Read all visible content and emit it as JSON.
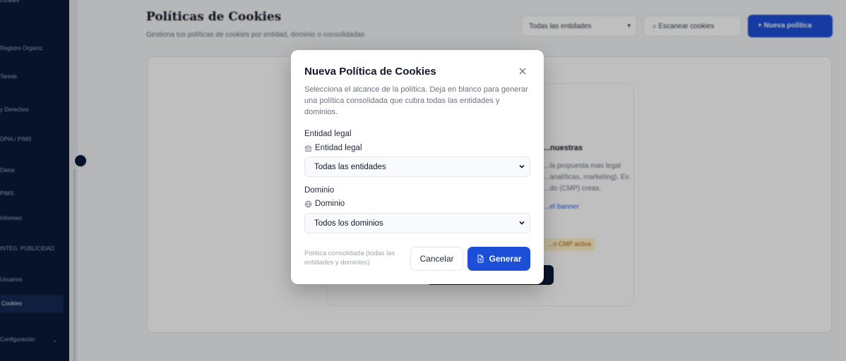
{
  "sidebar": {
    "items": [
      {
        "label": "cookies"
      },
      {
        "label": "Registro Organiz."
      },
      {
        "label": "Tareas"
      },
      {
        "label": "y Derechos"
      },
      {
        "label": "DPIA / PIMS"
      },
      {
        "label": "Datos"
      },
      {
        "label": "PIMS"
      },
      {
        "label": "Informes"
      },
      {
        "label": "INTEG. PÚBLICIDAD"
      },
      {
        "label": "Usuarios"
      },
      {
        "label": "Cookies"
      },
      {
        "label": "Configuración"
      }
    ]
  },
  "page": {
    "title": "Políticas de Cookies",
    "subtitle": "Gestiona tus políticas de cookies por entidad, dominio o consolidadas",
    "entity_filter": "Todas las entidades",
    "scan_button": "Escanear cookies",
    "new_button": "Nueva política"
  },
  "background_card": {
    "heading": "...nuestras",
    "lines": [
      "...la propuesta mas legal",
      "...analíticas, marketing). Es",
      "...do (CMP) creas."
    ],
    "link": "...el banner",
    "badge": "...n CMP activa"
  },
  "modal": {
    "title": "Nueva Política de Cookies",
    "description": "Selecciona el alcance de la política. Deja en blanco para generar una política consolidada que cubra todas las entidades y dominios.",
    "entity": {
      "label": "Entidad legal",
      "sublabel": "Entidad legal",
      "value": "Todas las entidades"
    },
    "domain": {
      "label": "Dominio",
      "sublabel": "Dominio",
      "value": "Todos los dominios"
    },
    "footer_note": "Política consolidada (todas las entidades y dominios)",
    "cancel_label": "Cancelar",
    "generate_label": "Generar"
  },
  "colors": {
    "primary": "#1d4ed8",
    "sidebar": "#0b1a3a"
  },
  "icons": [
    "close-icon",
    "bank-icon",
    "globe-icon",
    "chevron-down-icon",
    "document-icon",
    "search-icon",
    "plus-icon"
  ]
}
